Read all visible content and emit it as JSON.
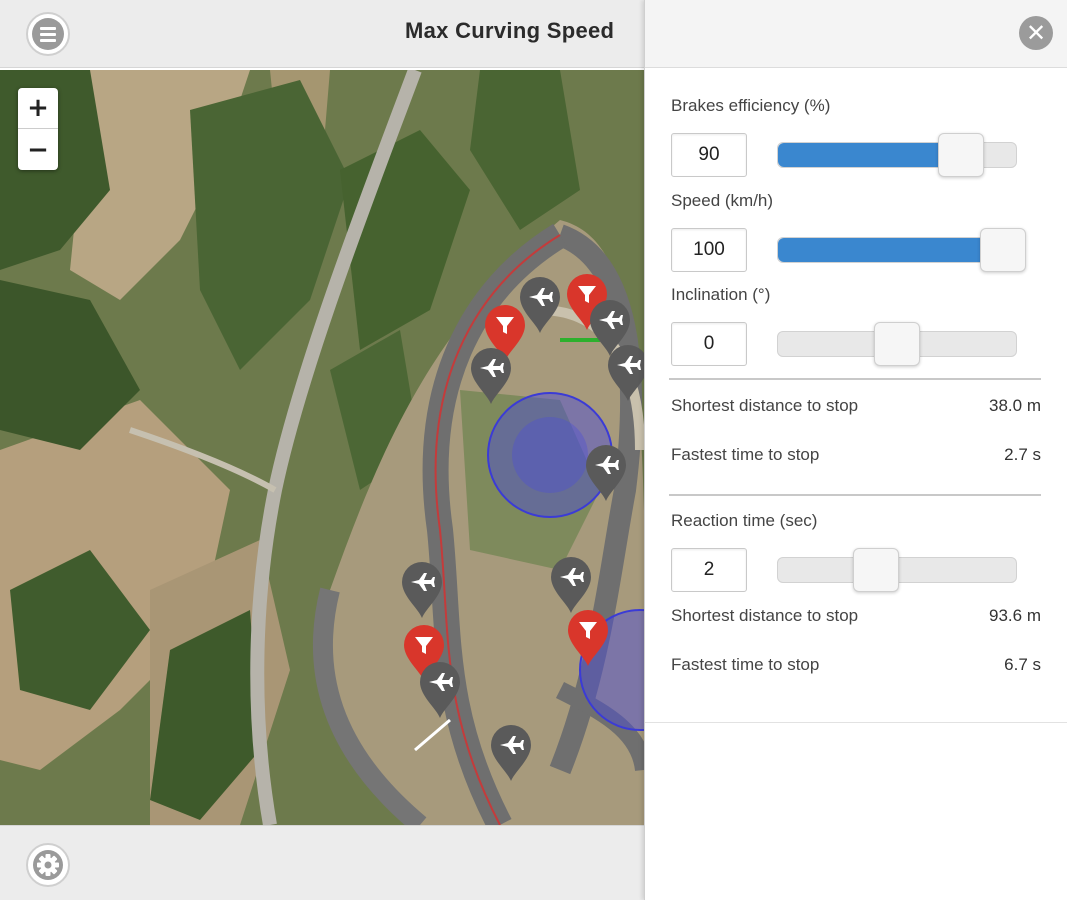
{
  "header": {
    "title": "Max Curving Speed",
    "menu_icon": "hamburger-menu-icon"
  },
  "map": {
    "zoom_in_label": "+",
    "zoom_out_label": "−",
    "marker_types": [
      "airplane-marker-icon",
      "filter-marker-icon"
    ],
    "colors": {
      "airplane_marker": "#5a5a5a",
      "filter_marker": "#d9362b",
      "zone": "#4a4adc"
    }
  },
  "footer": {
    "settings_icon": "gear-icon"
  },
  "panel": {
    "close_icon": "close-icon",
    "brakes": {
      "label": "Brakes efficiency (%)",
      "value": "90",
      "level": 0.8
    },
    "speed": {
      "label": "Speed (km/h)",
      "value": "100",
      "level": 1.0
    },
    "inclination": {
      "label": "Inclination (°)",
      "value": "0",
      "level": 0.5
    },
    "results1": {
      "distance_label": "Shortest distance to stop",
      "distance_value": "38.0 m",
      "time_label": "Fastest time to stop",
      "time_value": "2.7 s"
    },
    "reaction": {
      "label": "Reaction time (sec)",
      "value": "2",
      "level": 0.4
    },
    "results2": {
      "distance_label": "Shortest distance to stop",
      "distance_value": "93.6 m",
      "time_label": "Fastest time to stop",
      "time_value": "6.7 s"
    },
    "accent_color": "#3a87cf"
  }
}
